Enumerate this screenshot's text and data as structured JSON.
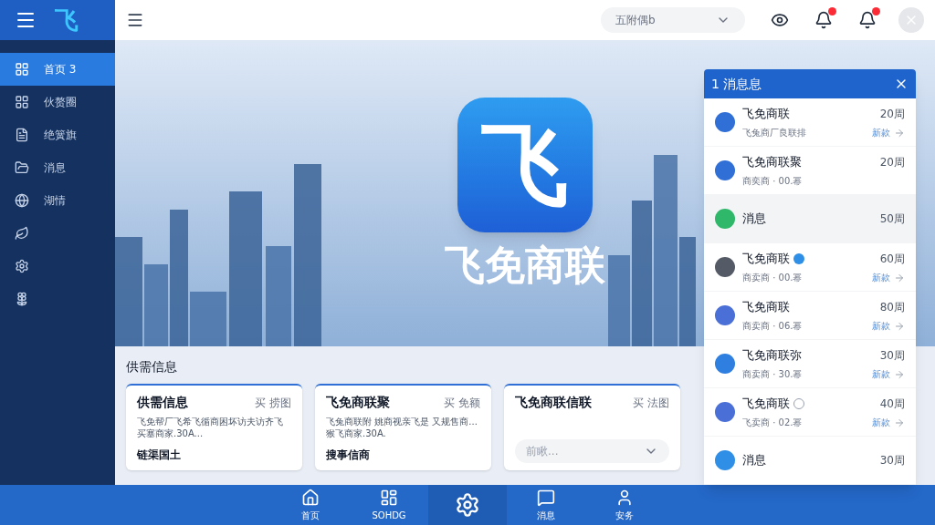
{
  "brand_mark": "飞",
  "sidebar": {
    "items": [
      {
        "label": "首页 3",
        "selected": true
      },
      {
        "label": "伙赘圈",
        "selected": false
      },
      {
        "label": "绝簧旗",
        "selected": false
      },
      {
        "label": "消息",
        "selected": false
      },
      {
        "label": "湖情",
        "selected": false
      },
      {
        "selected": false
      },
      {
        "selected": false
      },
      {
        "selected": false
      }
    ]
  },
  "topbar": {
    "dropdown": {
      "value": "五附偶b"
    },
    "notifications": [
      {
        "badge": true
      },
      {
        "badge": true
      }
    ]
  },
  "hero": {
    "logo_glyph": "飞",
    "title": "飞免商联"
  },
  "section": {
    "title": "供需信息",
    "cards": [
      {
        "kind": "text",
        "title": "供需信息",
        "tag": "买 捞图",
        "description": "飞免帮厂飞希飞循商困坏访夫访齐飞买塞商家.30A...",
        "footer": "链渠国土"
      },
      {
        "kind": "text",
        "title": "飞免商联聚",
        "tag": "买 免额",
        "description": "飞兔商联附 姚商视亲飞是 又规售商...猴飞商家.30A.",
        "footer": "搜事信商"
      },
      {
        "kind": "select",
        "title": "飞免商联信联",
        "tag": "买 法图",
        "placeholder": "前瞅..."
      }
    ]
  },
  "panel": {
    "title": "1 消息息",
    "messages": [
      {
        "name": "飞免商联",
        "time": "20周",
        "sub": "飞兔商厂良联排",
        "action": "新款",
        "color": "#2f6fd6",
        "highlighted": false,
        "verified": false,
        "away": false
      },
      {
        "name": "飞免商联聚",
        "time": "20周",
        "sub": "商奕商 · 00.幂",
        "color": "#2f6fd6",
        "highlighted": false,
        "verified": false,
        "away": false
      },
      {
        "name": "消息",
        "time": "50周",
        "color": "#2fb86a",
        "highlighted": true,
        "verified": false,
        "away": false
      },
      {
        "name": "飞免商联",
        "time": "60周",
        "sub": "商卖商 · 00.幂",
        "action": "新款",
        "color": "#555b66",
        "highlighted": false,
        "verified": true,
        "away": false
      },
      {
        "name": "飞免商联",
        "time": "80周",
        "sub": "商卖商 · 06.幂",
        "action": "新款",
        "color": "#4a6fd6",
        "highlighted": false,
        "verified": false,
        "away": false
      },
      {
        "name": "飞免商联弥",
        "time": "30周",
        "sub": "商卖商 · 30.幂",
        "action": "新款",
        "color": "#2f7fe0",
        "highlighted": false,
        "verified": false,
        "away": false
      },
      {
        "name": "飞免商联",
        "time": "40周",
        "sub": "飞卖商 · 02.幂",
        "action": "新款",
        "color": "#4a6fd6",
        "highlighted": false,
        "verified": false,
        "away": true
      },
      {
        "name": "消息",
        "time": "30周",
        "color": "#2f8fe6",
        "highlighted": false,
        "verified": false,
        "away": false
      }
    ]
  },
  "bottom_nav": [
    {
      "label": "首页",
      "selected": false
    },
    {
      "label": "SOHDG",
      "selected": false
    },
    {
      "selected": true
    },
    {
      "label": "消息",
      "selected": false
    },
    {
      "label": "安务",
      "selected": false
    }
  ]
}
